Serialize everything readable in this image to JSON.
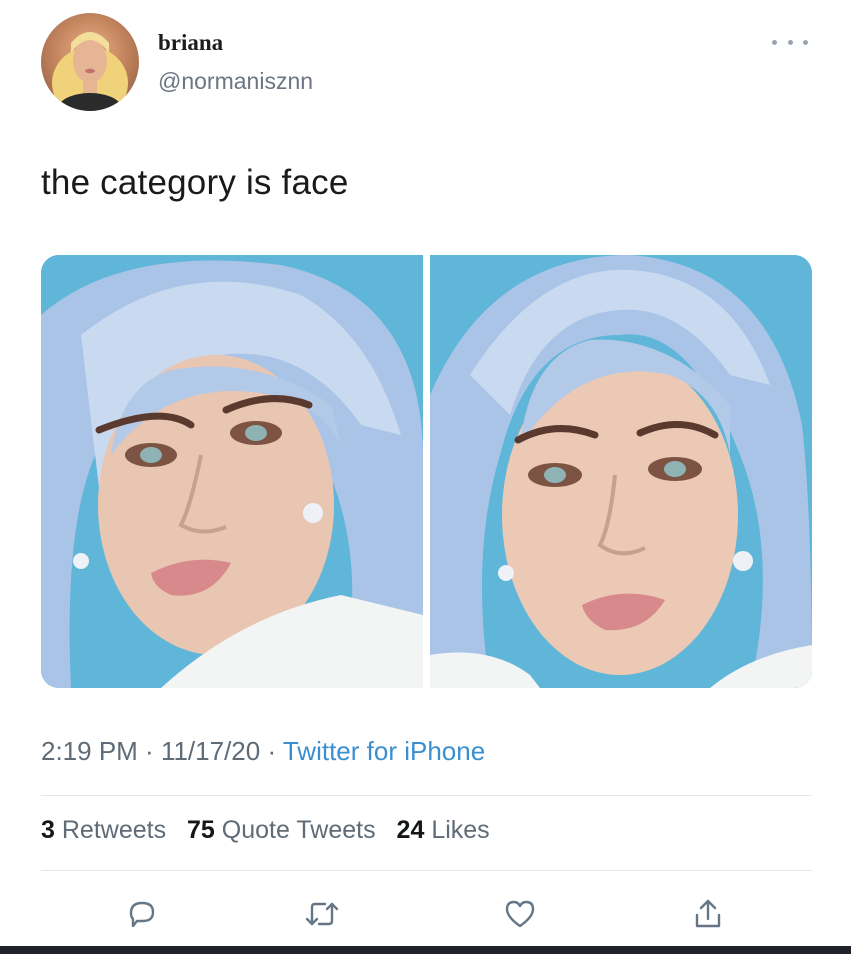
{
  "tweet": {
    "author": {
      "display_name": "briana",
      "handle": "@normanisznn",
      "avatar_icon": "profile-avatar"
    },
    "more_icon": "more-options-icon",
    "text": "the category is face",
    "media": [
      {
        "name": "photo-1",
        "description_icon": "portrait-photo"
      },
      {
        "name": "photo-2",
        "description_icon": "portrait-photo"
      }
    ],
    "meta": {
      "time": "2:19 PM",
      "date": "11/17/20",
      "source": "Twitter for iPhone",
      "separator": " · "
    },
    "stats": {
      "retweets_count": "3",
      "retweets_label": "Retweets",
      "quotes_count": "75",
      "quotes_label": "Quote Tweets",
      "likes_count": "24",
      "likes_label": "Likes"
    },
    "actions": [
      {
        "name": "reply",
        "icon": "reply-icon"
      },
      {
        "name": "retweet",
        "icon": "retweet-icon"
      },
      {
        "name": "like",
        "icon": "heart-icon"
      },
      {
        "name": "share",
        "icon": "share-icon"
      }
    ]
  },
  "colors": {
    "source_link": "#3a8fd0",
    "muted_text": "#5f6b76",
    "photo_background": "#5fb6d8",
    "hair": "#a9c4e6"
  }
}
